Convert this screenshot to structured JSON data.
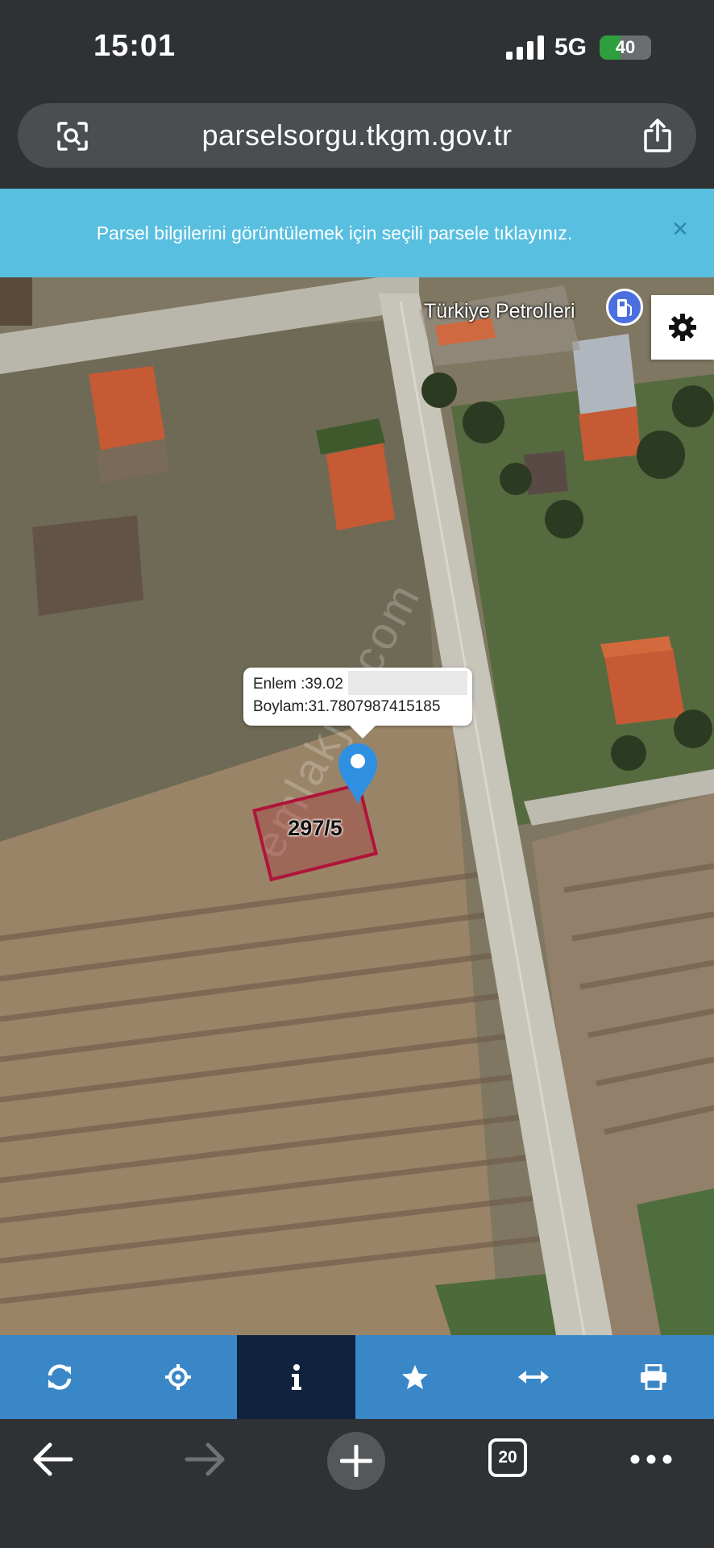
{
  "status_bar": {
    "time": "15:01",
    "network": "5G",
    "battery": "40",
    "battery_level": 0.4
  },
  "browser": {
    "url": "parselsorgu.tkgm.gov.tr",
    "tab_count": "20"
  },
  "banner": {
    "message": "Parsel bilgilerini görüntülemek için seçili parsele tıklayınız.",
    "close_symbol": "×"
  },
  "map": {
    "poi_name": "Türkiye Petrolleri",
    "popup": {
      "lat_line": "Enlem  :39.02",
      "lon_line": "Boylam:31.7807987415185"
    },
    "parcel_label": "297/5",
    "watermark": "emlakjet.com"
  },
  "toolbar": {
    "items": [
      "refresh-icon",
      "locate-icon",
      "info-icon",
      "star-icon",
      "measure-icon",
      "print-icon"
    ],
    "active": "info-icon"
  },
  "colors": {
    "banner": "#58bfe0",
    "toolbar": "#3a87c8",
    "toolbar_active": "#10223d",
    "parcel": "#b0143a",
    "pin": "#2f8fe0"
  }
}
